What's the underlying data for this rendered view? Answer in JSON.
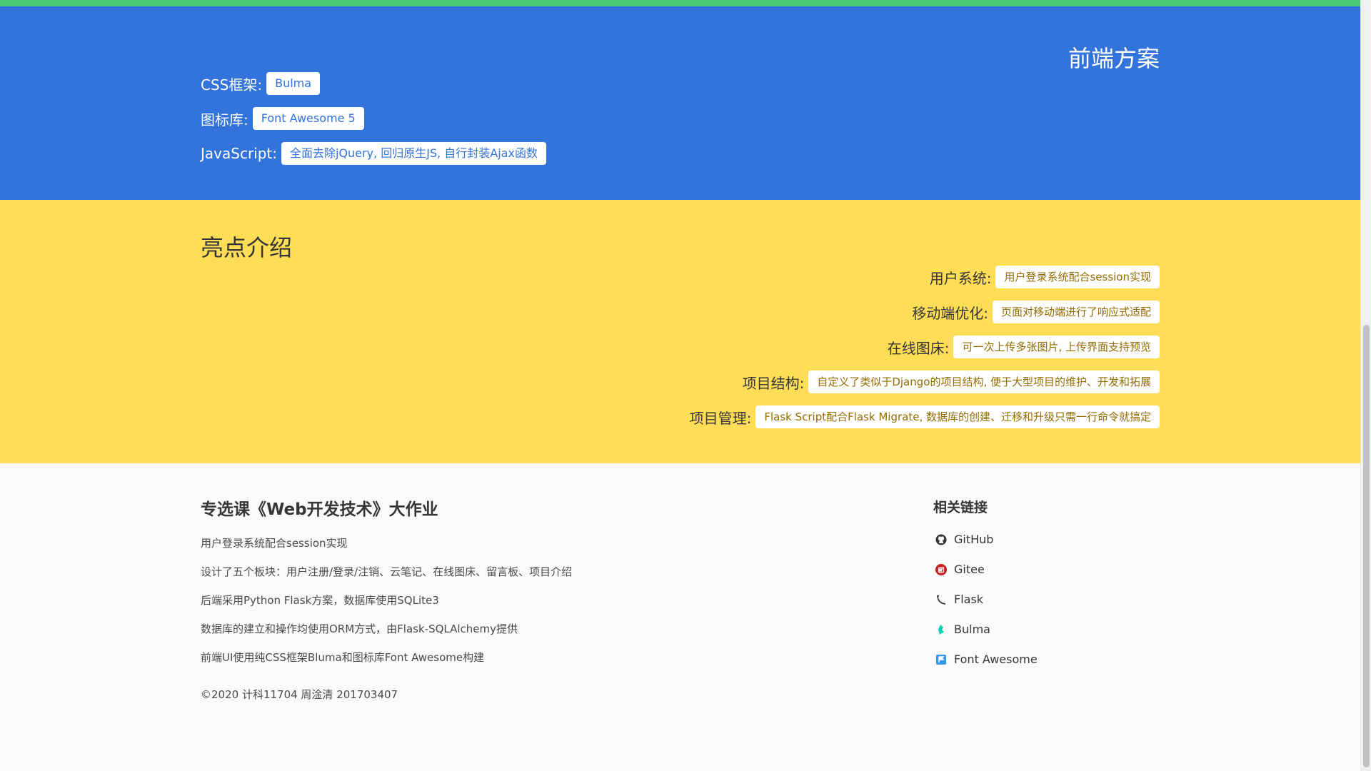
{
  "frontend": {
    "title": "前端方案",
    "rows": [
      {
        "label": "CSS框架:",
        "tag": "Bulma"
      },
      {
        "label": "图标库:",
        "tag": "Font Awesome 5"
      },
      {
        "label": "JavaScript:",
        "tag": "全面去除jQuery, 回归原生JS, 自行封装Ajax函数"
      }
    ]
  },
  "highlights": {
    "title": "亮点介绍",
    "rows": [
      {
        "label": "用户系统:",
        "tag": "用户登录系统配合session实现"
      },
      {
        "label": "移动端优化:",
        "tag": "页面对移动端进行了响应式适配"
      },
      {
        "label": "在线图床:",
        "tag": "可一次上传多张图片, 上传界面支持预览"
      },
      {
        "label": "项目结构:",
        "tag": "自定义了类似于Django的项目结构, 便于大型项目的维护、开发和拓展"
      },
      {
        "label": "项目管理:",
        "tag": "Flask Script配合Flask Migrate, 数据库的创建、迁移和升级只需一行命令就搞定"
      }
    ]
  },
  "footer": {
    "title": "专选课《Web开发技术》大作业",
    "lines": [
      "用户登录系统配合session实现",
      "设计了五个板块：用户注册/登录/注销、云笔记、在线图床、留言板、项目介绍",
      "后端采用Python Flask方案，数据库使用SQLite3",
      "数据库的建立和操作均使用ORM方式，由Flask-SQLAlchemy提供",
      "前端UI使用纯CSS框架Bluma和图标库Font Awesome构建"
    ],
    "copyright": "©2020 计科11704 周淦清 201703407",
    "links_title": "相关链接",
    "links": [
      {
        "label": "GitHub",
        "icon": "github-icon"
      },
      {
        "label": "Gitee",
        "icon": "gitee-icon"
      },
      {
        "label": "Flask",
        "icon": "flask-icon"
      },
      {
        "label": "Bulma",
        "icon": "bulma-icon"
      },
      {
        "label": "Font Awesome",
        "icon": "font-awesome-icon"
      }
    ]
  },
  "colors": {
    "green": "#48c774",
    "blue": "#3273dc",
    "yellow": "#ffdd57",
    "gitee_red": "#c71d23",
    "bulma_teal": "#00d1b2",
    "fa_blue": "#339af0"
  }
}
